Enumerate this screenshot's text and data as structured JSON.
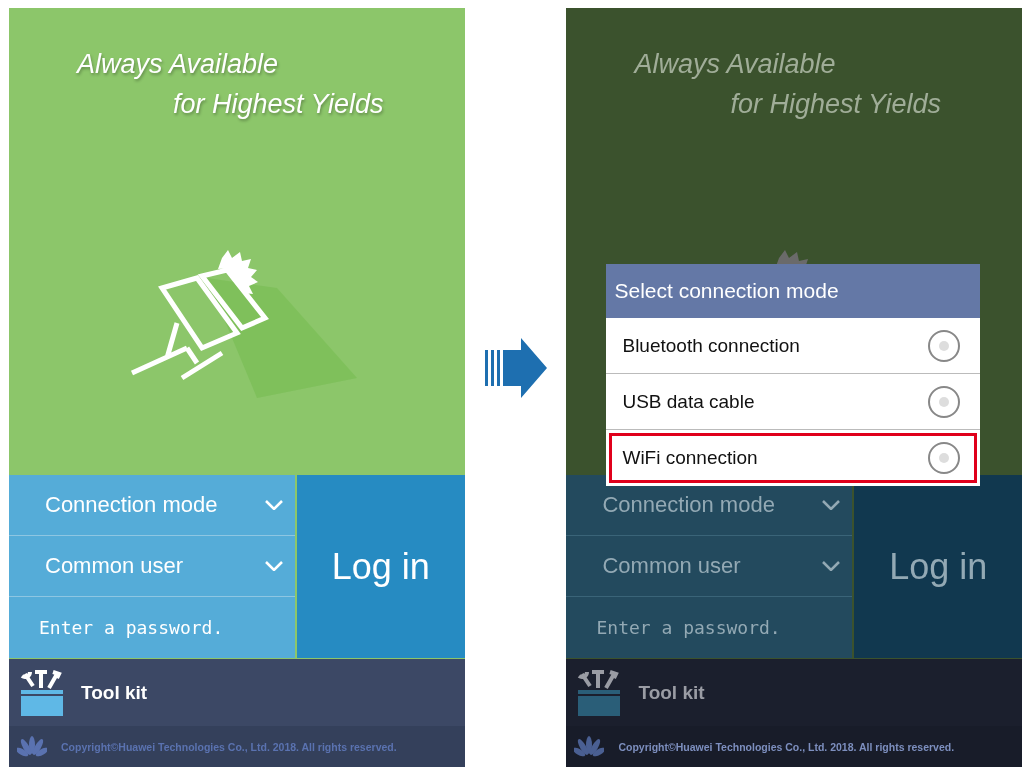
{
  "screens": [
    {
      "dimmed": false,
      "headline": [
        "Always Available",
        "for Highest Yields"
      ],
      "connection_mode": "Connection mode",
      "user_type": "Common user",
      "password": {
        "placeholder": "Enter a password."
      },
      "login_button": "Log in",
      "toolkit": "Tool kit",
      "copyright": "Copyright©Huawei Technologies Co., Ltd. 2018. All rights reserved."
    },
    {
      "dimmed": true,
      "headline": [
        "Always Available",
        "for Highest Yields"
      ],
      "connection_mode": "Connection mode",
      "user_type": "Common user",
      "password": {
        "placeholder": "Enter a password."
      },
      "login_button": "Log in",
      "toolkit": "Tool kit",
      "copyright": "Copyright©Huawei Technologies Co., Ltd. 2018. All rights reserved.",
      "dialog": {
        "title": "Select connection mode",
        "options": [
          {
            "label": "Bluetooth connection",
            "selected": false,
            "highlighted": false
          },
          {
            "label": "USB data cable",
            "selected": false,
            "highlighted": false
          },
          {
            "label": "WiFi connection",
            "selected": false,
            "highlighted": true
          }
        ]
      }
    }
  ]
}
